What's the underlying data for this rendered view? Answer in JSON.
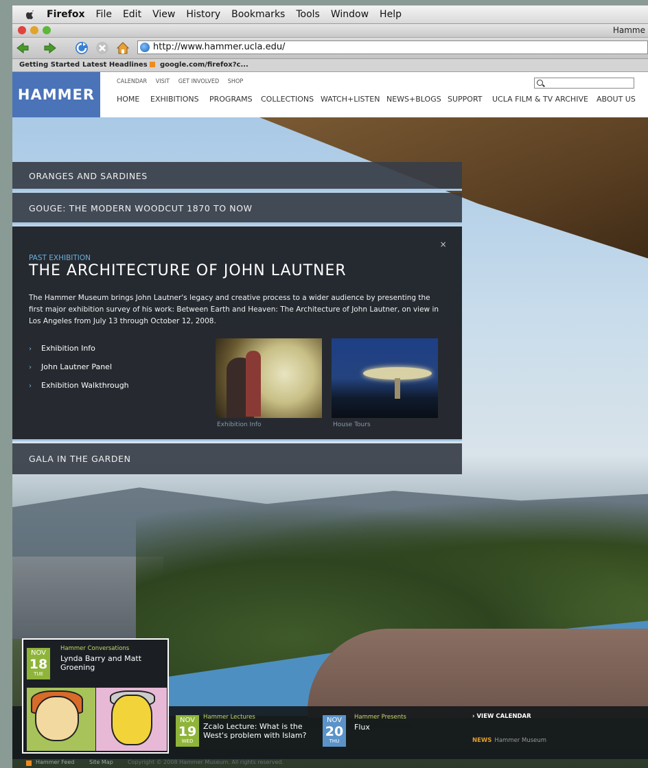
{
  "menubar": {
    "app": "Firefox",
    "items": [
      "File",
      "Edit",
      "View",
      "History",
      "Bookmarks",
      "Tools",
      "Window",
      "Help"
    ]
  },
  "window": {
    "title": "Hamme"
  },
  "toolbar": {
    "url": "http://www.hammer.ucla.edu/"
  },
  "bookmarks": [
    "Getting Started",
    "Latest Headlines",
    "google.com/firefox?c..."
  ],
  "site": {
    "logo": "HAMMER",
    "subnav": [
      "CALENDAR",
      "VISIT",
      "GET INVOLVED",
      "SHOP"
    ],
    "mainnav": [
      "HOME",
      "EXHIBITIONS",
      "PROGRAMS",
      "COLLECTIONS",
      "WATCH+LISTEN",
      "NEWS+BLOGS",
      "SUPPORT",
      "UCLA FILM & TV ARCHIVE",
      "ABOUT US"
    ],
    "search_placeholder": ""
  },
  "accordion": {
    "item1": "ORANGES AND SARDINES",
    "item2": "GOUGE: THE MODERN WOODCUT 1870 TO NOW",
    "open": {
      "kicker": "PAST EXHIBITION",
      "title": "THE ARCHITECTURE OF JOHN LAUTNER",
      "description": "The Hammer Museum brings John Lautner's legacy and creative process to a wider audience by presenting the first major exhibition survey of his work: Between Earth and Heaven: The Architecture of John Lautner, on view in Los Angeles from July 13 through October 12, 2008.",
      "links": [
        "Exhibition Info",
        "John Lautner Panel",
        "Exhibition Walkthrough"
      ],
      "close": "×",
      "thumb1_caption": "Exhibition Info",
      "thumb2_caption": "House Tours"
    },
    "item3": "GALA IN THE GARDEN"
  },
  "events": [
    {
      "month": "NOV",
      "day": "18",
      "weekday": "TUE",
      "category": "Hammer Conversations",
      "title": "Lynda Barry and Matt Groening",
      "color": "#8fb43a"
    },
    {
      "month": "NOV",
      "day": "19",
      "weekday": "WED",
      "category": "Hammer Lectures",
      "title": "Zcalo Lecture: What is the West's problem with Islam?",
      "color": "#8fb43a"
    },
    {
      "month": "NOV",
      "day": "20",
      "weekday": "THU",
      "category": "Hammer Presents",
      "title": "Flux",
      "color": "#5b93c8"
    }
  ],
  "sidebar_links": {
    "view_calendar": "› VIEW CALENDAR",
    "news_label": "NEWS",
    "news_source": "Hammer Museum"
  },
  "footer": {
    "feed": "Hammer Feed",
    "sitemap": "Site Map",
    "copyright": "Copyright © 2008 Hammer Museum. All rights reserved."
  }
}
